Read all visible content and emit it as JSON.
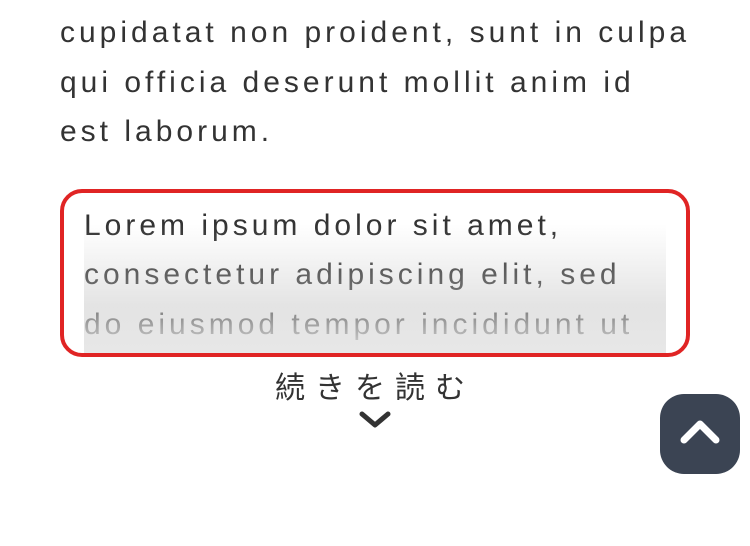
{
  "colors": {
    "highlight_border": "#e02424",
    "scroll_btn_bg": "#3b4453",
    "text": "#333333"
  },
  "paragraph_top": "cupidatat non proident, sunt in culpa qui officia deserunt mollit anim id est laborum.",
  "collapsed_preview": "Lorem ipsum dolor sit amet, consectetur adipiscing elit, sed do eiusmod tempor incididunt ut",
  "read_more_label": "続きを読む"
}
